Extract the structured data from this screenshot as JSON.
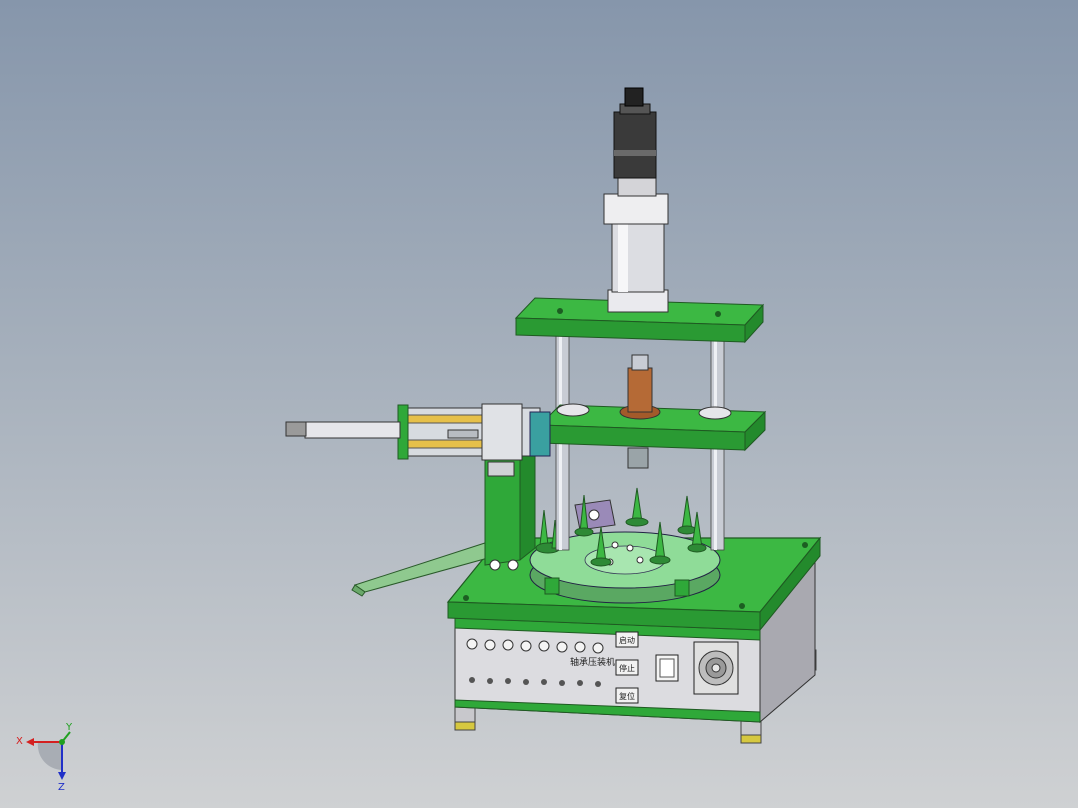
{
  "colors": {
    "background_top": "#8696ab",
    "background_bottom": "#cfd1d3",
    "frame_green": "#2fa839",
    "frame_green_dark": "#1f7a27",
    "turntable_green": "#7fd08a",
    "panel_grey": "#d8d8dc",
    "axis_x": "#d42020",
    "axis_y": "#20a020",
    "axis_z": "#2030c8"
  },
  "control_panel": {
    "title_label": "轴承压装机",
    "button_labels": [
      "启动",
      "停止",
      "复位"
    ],
    "indicator_count": 8
  },
  "triad": {
    "x_label": "X",
    "y_label": "Y",
    "z_label": "Z"
  }
}
